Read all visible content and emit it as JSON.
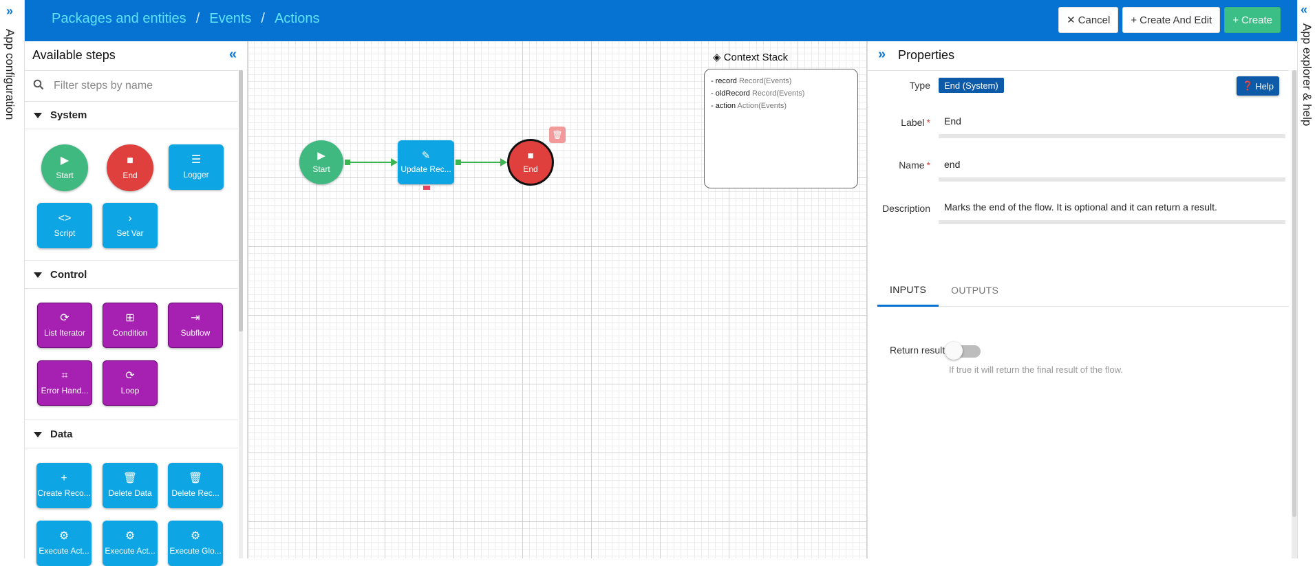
{
  "left_strip": {
    "label": "App configuration"
  },
  "right_strip": {
    "label": "App explorer & help"
  },
  "header": {
    "breadcrumb": [
      "Packages and entities",
      "Events",
      "Actions"
    ],
    "buttons": {
      "cancel": "Cancel",
      "create_and_edit": "Create And Edit",
      "create": "Create"
    },
    "colors": {
      "background": "#0673d3",
      "crumb": "#5fe3f5",
      "create": "#3cbf86"
    }
  },
  "steps_panel": {
    "title": "Available steps",
    "search_placeholder": "Filter steps by name",
    "categories": [
      {
        "name": "System",
        "items": [
          "Start",
          "End",
          "Logger",
          "Script",
          "Set Var"
        ]
      },
      {
        "name": "Control",
        "items": [
          "List Iterator",
          "Condition",
          "Subflow",
          "Error Hand...",
          "Loop"
        ]
      },
      {
        "name": "Data",
        "items": [
          "Create Reco...",
          "Delete Data",
          "Delete Rec...",
          "Execute Act...",
          "Execute Act...",
          "Execute Glo..."
        ]
      }
    ]
  },
  "canvas": {
    "nodes": {
      "start": "Start",
      "update": "Update Rec...",
      "end": "End"
    },
    "context_stack": {
      "title": "Context Stack",
      "rows": [
        {
          "key": "record",
          "type": "Record(Events)"
        },
        {
          "key": "oldRecord",
          "type": "Record(Events)"
        },
        {
          "key": "action",
          "type": "Action(Events)"
        }
      ]
    }
  },
  "properties": {
    "title": "Properties",
    "type_label": "Type",
    "type_value": "End (System)",
    "help": "Help",
    "label_label": "Label",
    "label_value": "End",
    "name_label": "Name",
    "name_value": "end",
    "description_label": "Description",
    "description_value": "Marks the end of the flow. It is optional and it can return a result.",
    "tabs": [
      "INPUTS",
      "OUTPUTS"
    ],
    "return_result_label": "Return result",
    "return_result_on": false,
    "return_result_hint": "If true it will return the final result of the flow."
  }
}
